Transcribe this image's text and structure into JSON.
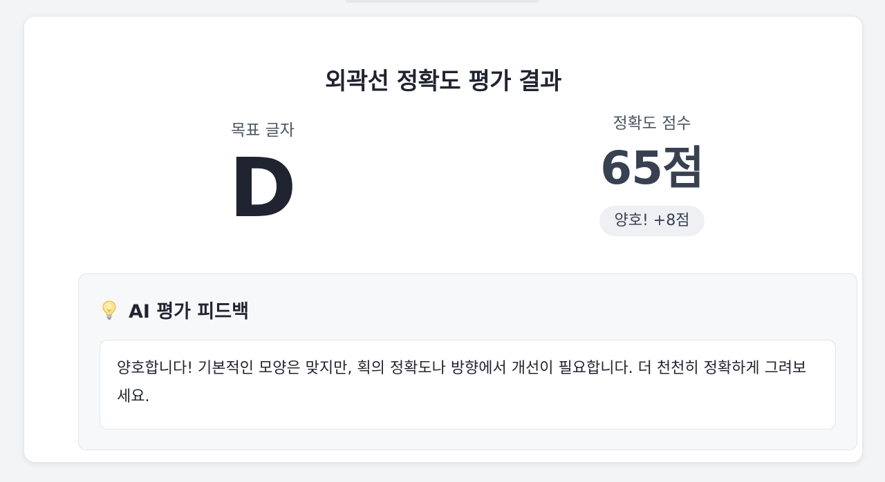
{
  "result": {
    "title": "외곽선 정확도 평가 결과",
    "target_label": "목표 글자",
    "target_letter": "D",
    "score_label": "정확도 점수",
    "score_value": "65점",
    "badge": "양호! +8점"
  },
  "feedback": {
    "icon": "lightbulb-icon",
    "title": "AI 평가 피드백",
    "text": "양호합니다! 기본적인 모양은 맞지만, 획의 정확도나 방향에서 개선이 필요합니다. 더 천천히 정확하게 그려보세요."
  }
}
